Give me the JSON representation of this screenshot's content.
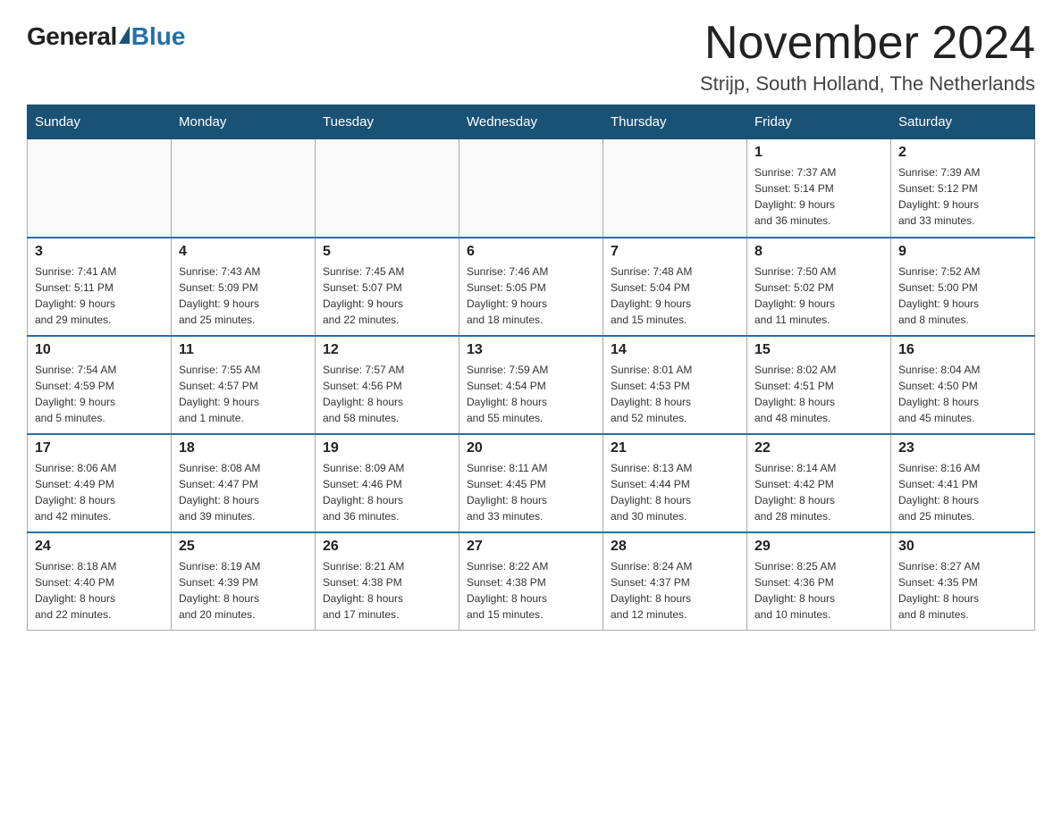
{
  "logo": {
    "general": "General",
    "blue": "Blue",
    "tagline": ""
  },
  "header": {
    "month_year": "November 2024",
    "location": "Strijp, South Holland, The Netherlands"
  },
  "days_of_week": [
    "Sunday",
    "Monday",
    "Tuesday",
    "Wednesday",
    "Thursday",
    "Friday",
    "Saturday"
  ],
  "weeks": [
    [
      {
        "day": "",
        "info": ""
      },
      {
        "day": "",
        "info": ""
      },
      {
        "day": "",
        "info": ""
      },
      {
        "day": "",
        "info": ""
      },
      {
        "day": "",
        "info": ""
      },
      {
        "day": "1",
        "info": "Sunrise: 7:37 AM\nSunset: 5:14 PM\nDaylight: 9 hours\nand 36 minutes."
      },
      {
        "day": "2",
        "info": "Sunrise: 7:39 AM\nSunset: 5:12 PM\nDaylight: 9 hours\nand 33 minutes."
      }
    ],
    [
      {
        "day": "3",
        "info": "Sunrise: 7:41 AM\nSunset: 5:11 PM\nDaylight: 9 hours\nand 29 minutes."
      },
      {
        "day": "4",
        "info": "Sunrise: 7:43 AM\nSunset: 5:09 PM\nDaylight: 9 hours\nand 25 minutes."
      },
      {
        "day": "5",
        "info": "Sunrise: 7:45 AM\nSunset: 5:07 PM\nDaylight: 9 hours\nand 22 minutes."
      },
      {
        "day": "6",
        "info": "Sunrise: 7:46 AM\nSunset: 5:05 PM\nDaylight: 9 hours\nand 18 minutes."
      },
      {
        "day": "7",
        "info": "Sunrise: 7:48 AM\nSunset: 5:04 PM\nDaylight: 9 hours\nand 15 minutes."
      },
      {
        "day": "8",
        "info": "Sunrise: 7:50 AM\nSunset: 5:02 PM\nDaylight: 9 hours\nand 11 minutes."
      },
      {
        "day": "9",
        "info": "Sunrise: 7:52 AM\nSunset: 5:00 PM\nDaylight: 9 hours\nand 8 minutes."
      }
    ],
    [
      {
        "day": "10",
        "info": "Sunrise: 7:54 AM\nSunset: 4:59 PM\nDaylight: 9 hours\nand 5 minutes."
      },
      {
        "day": "11",
        "info": "Sunrise: 7:55 AM\nSunset: 4:57 PM\nDaylight: 9 hours\nand 1 minute."
      },
      {
        "day": "12",
        "info": "Sunrise: 7:57 AM\nSunset: 4:56 PM\nDaylight: 8 hours\nand 58 minutes."
      },
      {
        "day": "13",
        "info": "Sunrise: 7:59 AM\nSunset: 4:54 PM\nDaylight: 8 hours\nand 55 minutes."
      },
      {
        "day": "14",
        "info": "Sunrise: 8:01 AM\nSunset: 4:53 PM\nDaylight: 8 hours\nand 52 minutes."
      },
      {
        "day": "15",
        "info": "Sunrise: 8:02 AM\nSunset: 4:51 PM\nDaylight: 8 hours\nand 48 minutes."
      },
      {
        "day": "16",
        "info": "Sunrise: 8:04 AM\nSunset: 4:50 PM\nDaylight: 8 hours\nand 45 minutes."
      }
    ],
    [
      {
        "day": "17",
        "info": "Sunrise: 8:06 AM\nSunset: 4:49 PM\nDaylight: 8 hours\nand 42 minutes."
      },
      {
        "day": "18",
        "info": "Sunrise: 8:08 AM\nSunset: 4:47 PM\nDaylight: 8 hours\nand 39 minutes."
      },
      {
        "day": "19",
        "info": "Sunrise: 8:09 AM\nSunset: 4:46 PM\nDaylight: 8 hours\nand 36 minutes."
      },
      {
        "day": "20",
        "info": "Sunrise: 8:11 AM\nSunset: 4:45 PM\nDaylight: 8 hours\nand 33 minutes."
      },
      {
        "day": "21",
        "info": "Sunrise: 8:13 AM\nSunset: 4:44 PM\nDaylight: 8 hours\nand 30 minutes."
      },
      {
        "day": "22",
        "info": "Sunrise: 8:14 AM\nSunset: 4:42 PM\nDaylight: 8 hours\nand 28 minutes."
      },
      {
        "day": "23",
        "info": "Sunrise: 8:16 AM\nSunset: 4:41 PM\nDaylight: 8 hours\nand 25 minutes."
      }
    ],
    [
      {
        "day": "24",
        "info": "Sunrise: 8:18 AM\nSunset: 4:40 PM\nDaylight: 8 hours\nand 22 minutes."
      },
      {
        "day": "25",
        "info": "Sunrise: 8:19 AM\nSunset: 4:39 PM\nDaylight: 8 hours\nand 20 minutes."
      },
      {
        "day": "26",
        "info": "Sunrise: 8:21 AM\nSunset: 4:38 PM\nDaylight: 8 hours\nand 17 minutes."
      },
      {
        "day": "27",
        "info": "Sunrise: 8:22 AM\nSunset: 4:38 PM\nDaylight: 8 hours\nand 15 minutes."
      },
      {
        "day": "28",
        "info": "Sunrise: 8:24 AM\nSunset: 4:37 PM\nDaylight: 8 hours\nand 12 minutes."
      },
      {
        "day": "29",
        "info": "Sunrise: 8:25 AM\nSunset: 4:36 PM\nDaylight: 8 hours\nand 10 minutes."
      },
      {
        "day": "30",
        "info": "Sunrise: 8:27 AM\nSunset: 4:35 PM\nDaylight: 8 hours\nand 8 minutes."
      }
    ]
  ]
}
